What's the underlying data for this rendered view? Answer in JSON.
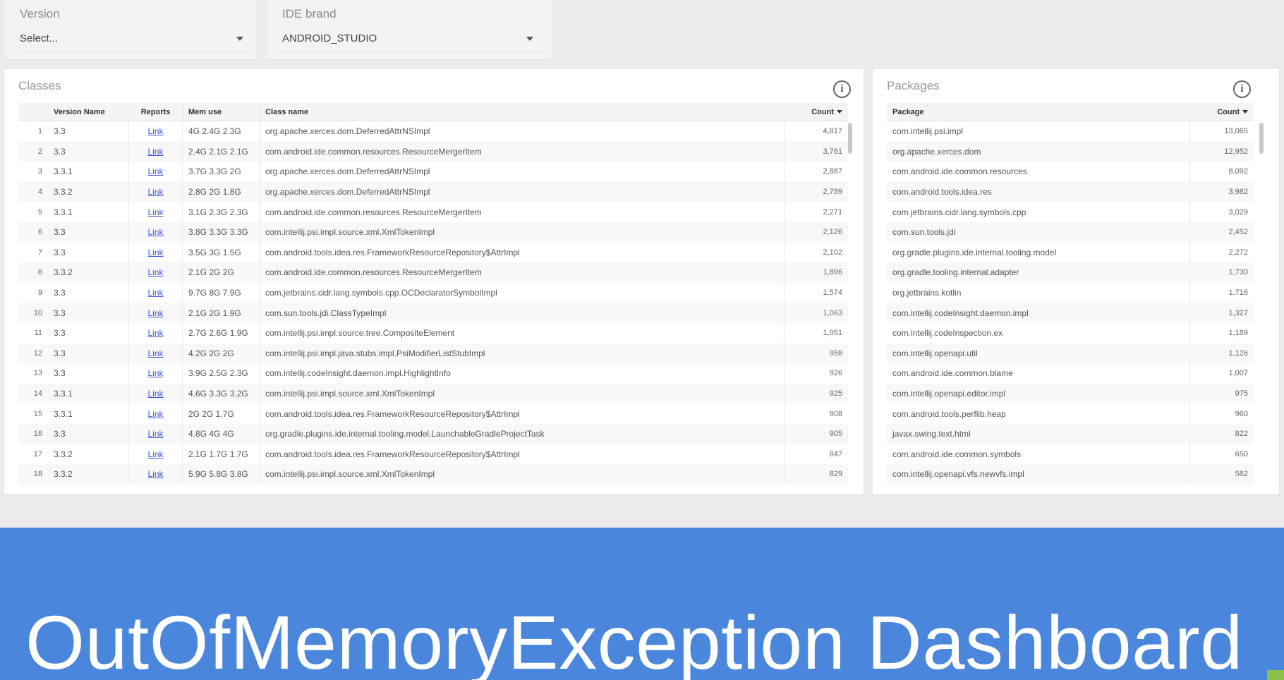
{
  "filters": {
    "version": {
      "label": "Version",
      "value": "Select..."
    },
    "ide_brand": {
      "label": "IDE brand",
      "value": "ANDROID_STUDIO"
    }
  },
  "classes": {
    "title": "Classes",
    "info_icon": "info-icon",
    "columns": [
      "Version Name",
      "Reports",
      "Mem use",
      "Class name",
      "Count"
    ],
    "rows": [
      {
        "idx": "1",
        "version": "3.3",
        "report": "Link",
        "mem": "4G 2.4G 2.3G",
        "class": "org.apache.xerces.dom.DeferredAttrNSImpl",
        "count": "4,817"
      },
      {
        "idx": "2",
        "version": "3.3",
        "report": "Link",
        "mem": "2.4G 2.1G 2.1G",
        "class": "com.android.ide.common.resources.ResourceMergerItem",
        "count": "3,761"
      },
      {
        "idx": "3",
        "version": "3.3.1",
        "report": "Link",
        "mem": "3.7G 3.3G 2G",
        "class": "org.apache.xerces.dom.DeferredAttrNSImpl",
        "count": "2,887"
      },
      {
        "idx": "4",
        "version": "3.3.2",
        "report": "Link",
        "mem": "2.8G 2G 1.8G",
        "class": "org.apache.xerces.dom.DeferredAttrNSImpl",
        "count": "2,789"
      },
      {
        "idx": "5",
        "version": "3.3.1",
        "report": "Link",
        "mem": "3.1G 2.3G 2.3G",
        "class": "com.android.ide.common.resources.ResourceMergerItem",
        "count": "2,271"
      },
      {
        "idx": "6",
        "version": "3.3",
        "report": "Link",
        "mem": "3.8G 3.3G 3.3G",
        "class": "com.intellij.psi.impl.source.xml.XmlTokenImpl",
        "count": "2,126"
      },
      {
        "idx": "7",
        "version": "3.3",
        "report": "Link",
        "mem": "3.5G 3G 1.5G",
        "class": "com.android.tools.idea.res.FrameworkResourceRepository$AttrImpl",
        "count": "2,102"
      },
      {
        "idx": "8",
        "version": "3.3.2",
        "report": "Link",
        "mem": "2.1G 2G 2G",
        "class": "com.android.ide.common.resources.ResourceMergerItem",
        "count": "1,896"
      },
      {
        "idx": "9",
        "version": "3.3",
        "report": "Link",
        "mem": "9.7G 8G 7.9G",
        "class": "com.jetbrains.cidr.lang.symbols.cpp.OCDeclaratorSymbolImpl",
        "count": "1,574"
      },
      {
        "idx": "10",
        "version": "3.3",
        "report": "Link",
        "mem": "2.1G 2G 1.9G",
        "class": "com.sun.tools.jdi.ClassTypeImpl",
        "count": "1,063"
      },
      {
        "idx": "11",
        "version": "3.3",
        "report": "Link",
        "mem": "2.7G 2.6G 1.9G",
        "class": "com.intellij.psi.impl.source.tree.CompositeElement",
        "count": "1,051"
      },
      {
        "idx": "12",
        "version": "3.3",
        "report": "Link",
        "mem": "4.2G 2G 2G",
        "class": "com.intellij.psi.impl.java.stubs.impl.PsiModifierListStubImpl",
        "count": "958"
      },
      {
        "idx": "13",
        "version": "3.3",
        "report": "Link",
        "mem": "3.9G 2.5G 2.3G",
        "class": "com.intellij.codeInsight.daemon.impl.HighlightInfo",
        "count": "926"
      },
      {
        "idx": "14",
        "version": "3.3.1",
        "report": "Link",
        "mem": "4.6G 3.3G 3.2G",
        "class": "com.intellij.psi.impl.source.xml.XmlTokenImpl",
        "count": "925"
      },
      {
        "idx": "15",
        "version": "3.3.1",
        "report": "Link",
        "mem": "2G 2G 1.7G",
        "class": "com.android.tools.idea.res.FrameworkResourceRepository$AttrImpl",
        "count": "908"
      },
      {
        "idx": "16",
        "version": "3.3",
        "report": "Link",
        "mem": "4.8G 4G 4G",
        "class": "org.gradle.plugins.ide.internal.tooling.model.LaunchableGradleProjectTask",
        "count": "905"
      },
      {
        "idx": "17",
        "version": "3.3.2",
        "report": "Link",
        "mem": "2.1G 1.7G 1.7G",
        "class": "com.android.tools.idea.res.FrameworkResourceRepository$AttrImpl",
        "count": "847"
      },
      {
        "idx": "18",
        "version": "3.3.2",
        "report": "Link",
        "mem": "5.9G 5.8G 3.8G",
        "class": "com.intellij.psi.impl.source.xml.XmlTokenImpl",
        "count": "829"
      }
    ]
  },
  "packages": {
    "title": "Packages",
    "info_icon": "info-icon",
    "columns": [
      "Package",
      "Count"
    ],
    "rows": [
      {
        "pkg": "com.intellij.psi.impl",
        "count": "13,065"
      },
      {
        "pkg": "org.apache.xerces.dom",
        "count": "12,952"
      },
      {
        "pkg": "com.android.ide.common.resources",
        "count": "8,092"
      },
      {
        "pkg": "com.android.tools.idea.res",
        "count": "3,982"
      },
      {
        "pkg": "com.jetbrains.cidr.lang.symbols.cpp",
        "count": "3,029"
      },
      {
        "pkg": "com.sun.tools.jdi",
        "count": "2,452"
      },
      {
        "pkg": "org.gradle.plugins.ide.internal.tooling.model",
        "count": "2,272"
      },
      {
        "pkg": "org.gradle.tooling.internal.adapter",
        "count": "1,730"
      },
      {
        "pkg": "org.jetbrains.kotlin",
        "count": "1,716"
      },
      {
        "pkg": "com.intellij.codeInsight.daemon.impl",
        "count": "1,327"
      },
      {
        "pkg": "com.intellij.codeInspection.ex",
        "count": "1,189"
      },
      {
        "pkg": "com.intellij.openapi.util",
        "count": "1,126"
      },
      {
        "pkg": "com.android.ide.common.blame",
        "count": "1,007"
      },
      {
        "pkg": "com.intellij.openapi.editor.impl",
        "count": "975"
      },
      {
        "pkg": "com.android.tools.perflib.heap",
        "count": "960"
      },
      {
        "pkg": "javax.swing.text.html",
        "count": "822"
      },
      {
        "pkg": "com.android.ide.common.symbols",
        "count": "650"
      },
      {
        "pkg": "com.intellij.openapi.vfs.newvfs.impl",
        "count": "582"
      }
    ]
  },
  "banner": {
    "title": "OutOfMemoryException Dashboard",
    "color": "#4a86dc"
  }
}
